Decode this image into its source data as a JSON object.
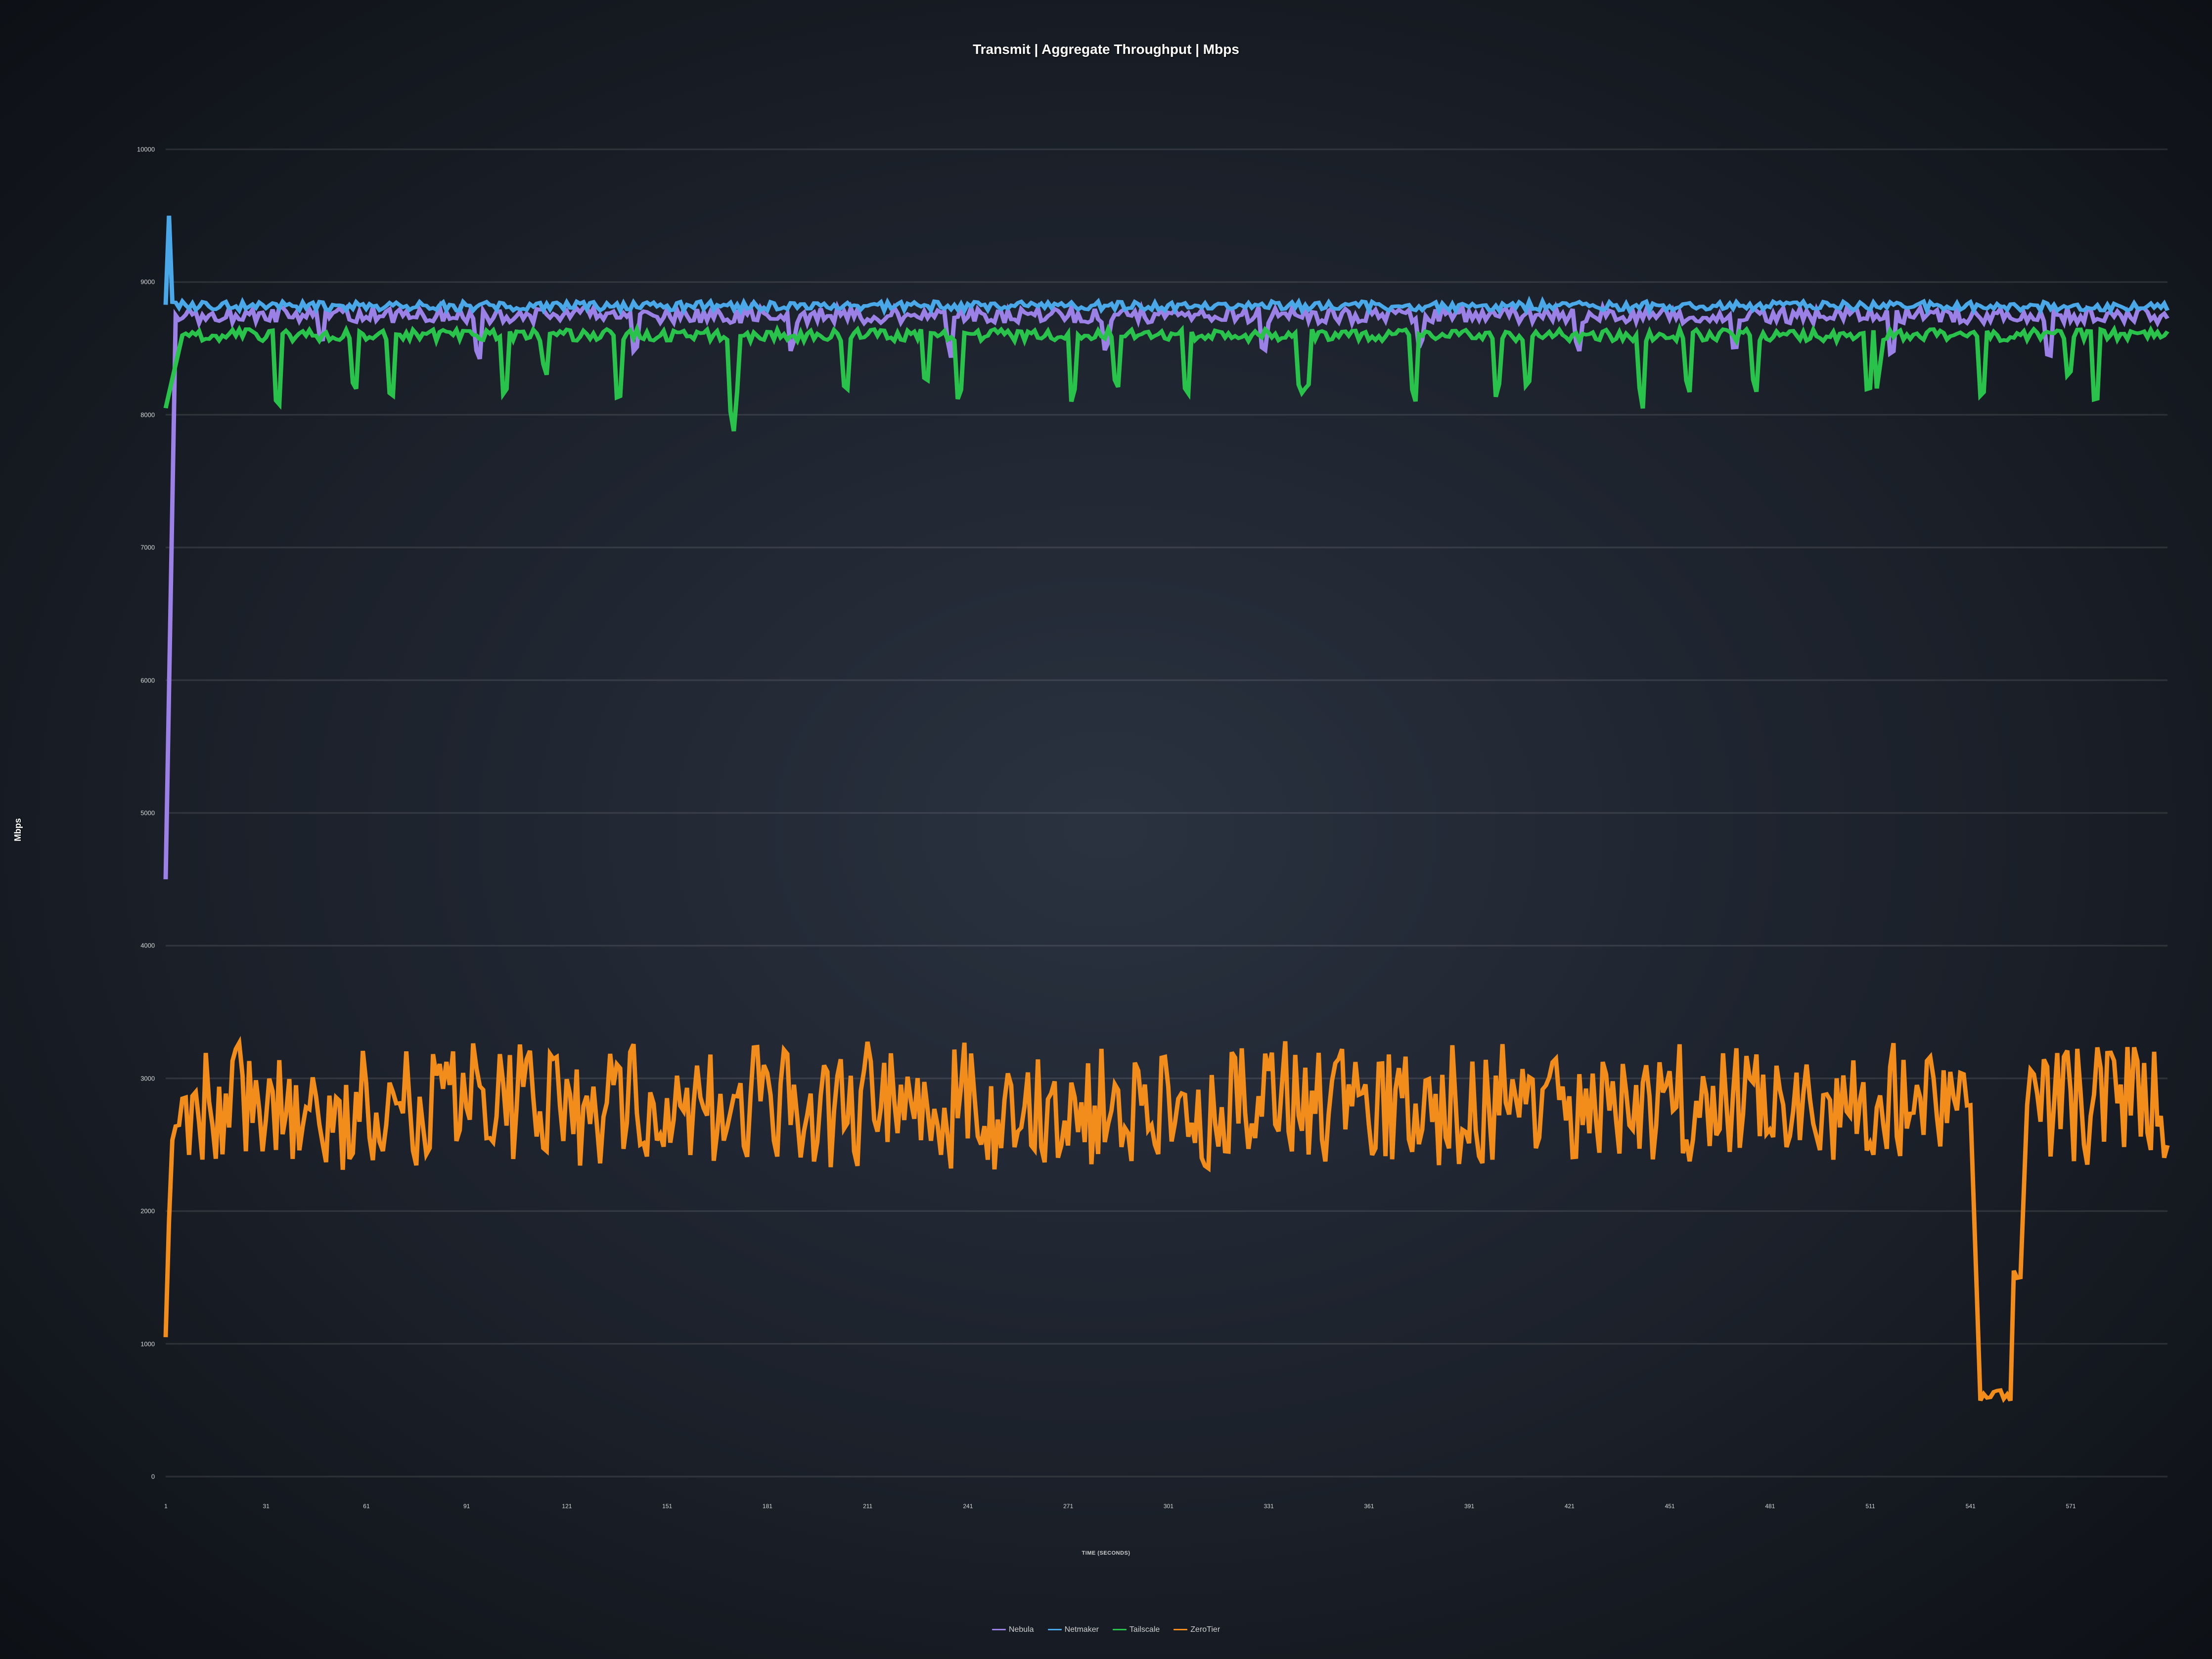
{
  "chart_data": {
    "type": "line",
    "title": "Transmit | Aggregate Throughput | Mbps",
    "xlabel": "TIME (SECONDS)",
    "ylabel": "Mbps",
    "xlim": [
      1,
      600
    ],
    "ylim": [
      0,
      10000
    ],
    "xticks": [
      1,
      31,
      61,
      91,
      121,
      151,
      181,
      211,
      241,
      271,
      301,
      331,
      361,
      391,
      421,
      451,
      481,
      511,
      541,
      571
    ],
    "yticks": [
      0,
      1000,
      2000,
      3000,
      4000,
      5000,
      6000,
      7000,
      8000,
      9000,
      10000
    ],
    "series": [
      {
        "name": "Nebula",
        "color": "#9b80e6",
        "approx_mean": 8750,
        "approx_range": [
          8400,
          8850
        ],
        "startup_value": 4500,
        "note": "rises from ~4500 at t≈1 to ~8750 steady; inherits Netmaker 9500 spike overlap visually at t≈2"
      },
      {
        "name": "Netmaker",
        "color": "#4aa8e8",
        "approx_mean": 8820,
        "approx_range": [
          8750,
          8900
        ],
        "startup_value": 8820,
        "startup_spike": 9500,
        "note": "brief spike to ~9500 at t≈2 then flat ~8820"
      },
      {
        "name": "Tailscale",
        "color": "#29c24a",
        "approx_mean": 8600,
        "approx_range": [
          8000,
          8750
        ],
        "startup_value": 8050,
        "note": "rises from ~8050, periodic dips to ~8050–8200 roughly every 30–40s"
      },
      {
        "name": "ZeroTier",
        "color": "#f28c1a",
        "approx_mean": 2800,
        "approx_range": [
          2300,
          3250
        ],
        "startup_value": 1050,
        "dip": {
          "start": 541,
          "end": 558,
          "min_value": 600,
          "recovery_step": 1500
        },
        "note": "noisy around 2800; deep drop to ~600 around t≈541–555 then step recovery"
      }
    ],
    "legend_position": "bottom"
  }
}
